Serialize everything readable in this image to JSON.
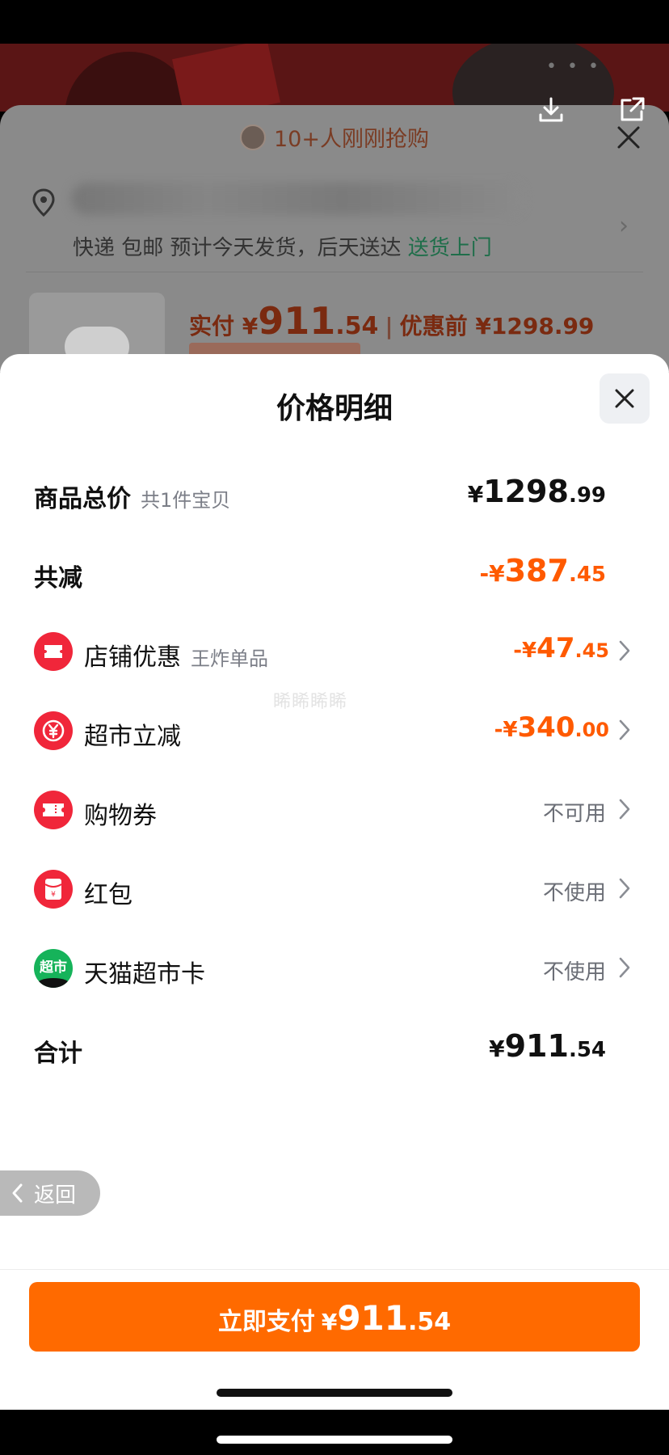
{
  "background": {
    "buy_notice": "10+人刚刚抢购",
    "shipping_text": "快递 包邮 预计今天发货，后天送达",
    "shipping_link": "送货上门",
    "paid_label": "实付 ¥",
    "paid_int": "911",
    "paid_dec": ".54",
    "original_label": "优惠前 ¥1298.99"
  },
  "sheet": {
    "title": "价格明细",
    "rows": {
      "total": {
        "label": "商品总价",
        "sub": "共1件宝贝",
        "cur": "¥",
        "int": "1298",
        "dec": ".99"
      },
      "reduction": {
        "label": "共减",
        "cur": "-¥",
        "int": "387",
        "dec": ".45"
      },
      "store": {
        "label": "店铺优惠",
        "sub": "王炸单品",
        "cur": "-¥",
        "int": "47",
        "dec": ".45"
      },
      "market": {
        "label": "超市立减",
        "cur": "-¥",
        "int": "340",
        "dec": ".00"
      },
      "voucher": {
        "label": "购物券",
        "status": "不可用"
      },
      "redpack": {
        "label": "红包",
        "status": "不使用"
      },
      "tmall_card": {
        "label": "天猫超市卡",
        "status": "不使用",
        "icon_text": "超市"
      },
      "sum": {
        "label": "合计",
        "cur": "¥",
        "int": "911",
        "dec": ".54"
      }
    },
    "watermark": "睎睎睎睎"
  },
  "back_button": {
    "label": "返回"
  },
  "pay_button": {
    "label": "立即支付",
    "cur": "¥",
    "int": "911",
    "dec": ".54"
  },
  "colors": {
    "accent": "#ff6a00",
    "discount": "#ff5a00",
    "icon_red": "#f0263a",
    "icon_green": "#16b35a"
  }
}
